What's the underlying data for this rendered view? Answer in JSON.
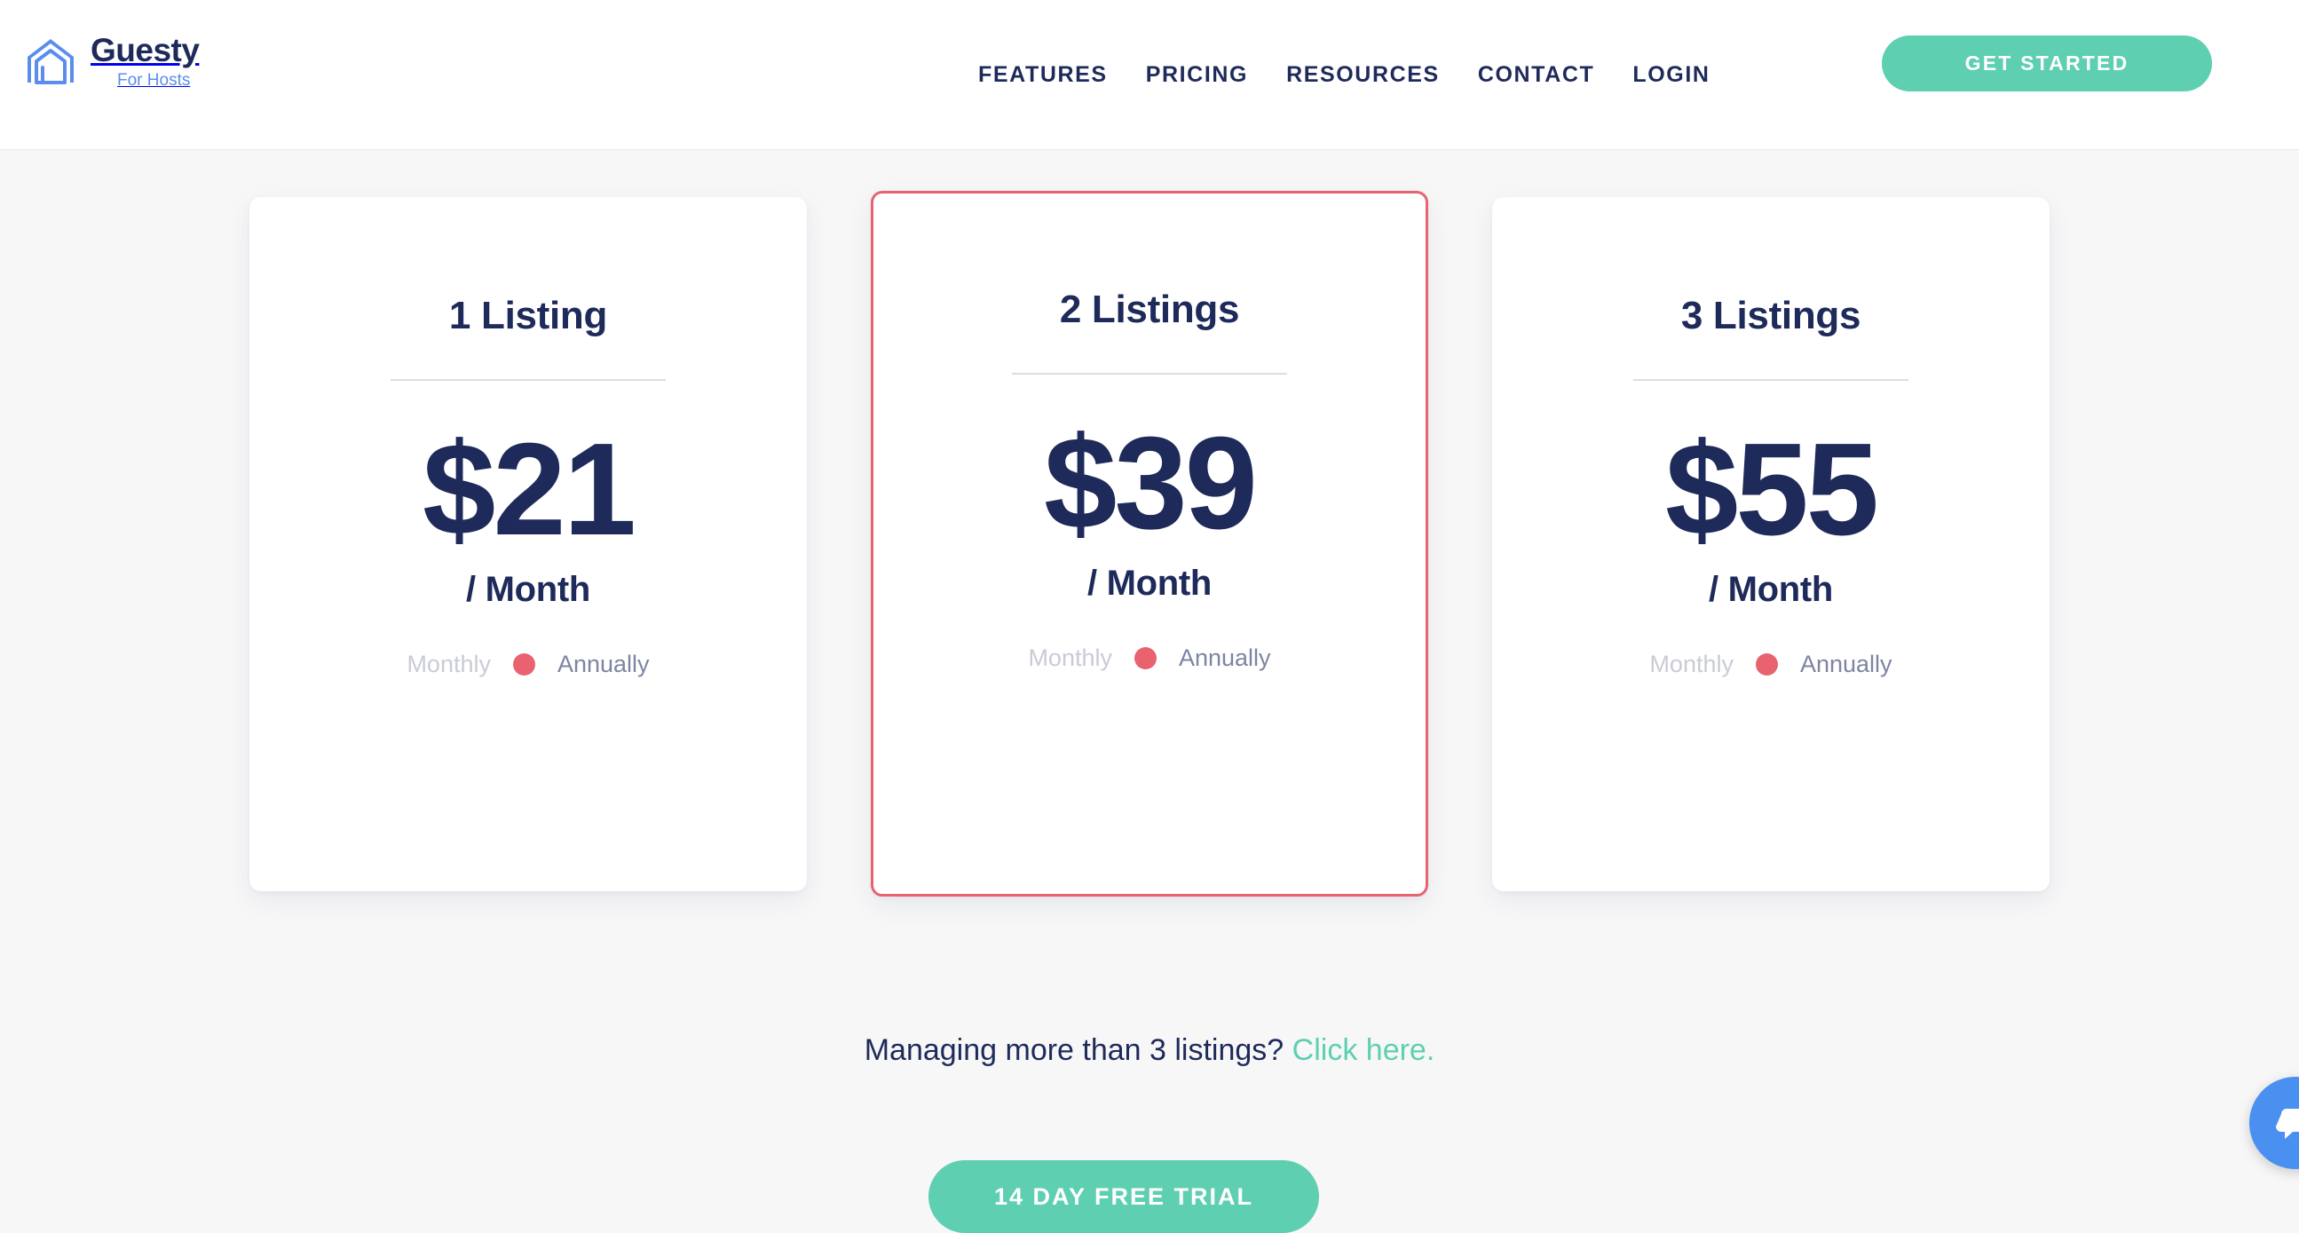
{
  "header": {
    "logo": {
      "name": "Guesty",
      "tagline": "For Hosts",
      "icon": "house-outline-icon",
      "color": "#5b8def"
    },
    "nav": [
      {
        "label": "FEATURES"
      },
      {
        "label": "PRICING"
      },
      {
        "label": "RESOURCES"
      },
      {
        "label": "CONTACT"
      },
      {
        "label": "LOGIN"
      }
    ],
    "cta_label": "GET STARTED",
    "cta_color": "#5ecfb1"
  },
  "pricing": {
    "cards": [
      {
        "title": "1 Listing",
        "price": "$21",
        "period": "/ Month",
        "billing_left": "Monthly",
        "billing_right": "Annually",
        "featured": false
      },
      {
        "title": "2 Listings",
        "price": "$39",
        "period": "/ Month",
        "billing_left": "Monthly",
        "billing_right": "Annually",
        "featured": true
      },
      {
        "title": "3 Listings",
        "price": "$55",
        "period": "/ Month",
        "billing_left": "Monthly",
        "billing_right": "Annually",
        "featured": false
      }
    ],
    "featured_border_color": "#e8636f",
    "toggle_dot_color": "#e8636f",
    "price_color": "#1e2a5a"
  },
  "footer": {
    "more_text": "Managing more than 3 listings?",
    "more_link": "Click here.",
    "link_color": "#5ecfb1",
    "trial_button": "14 DAY FREE TRIAL"
  },
  "chat": {
    "icon": "chat-bubble-icon",
    "color": "#4a90f0"
  }
}
